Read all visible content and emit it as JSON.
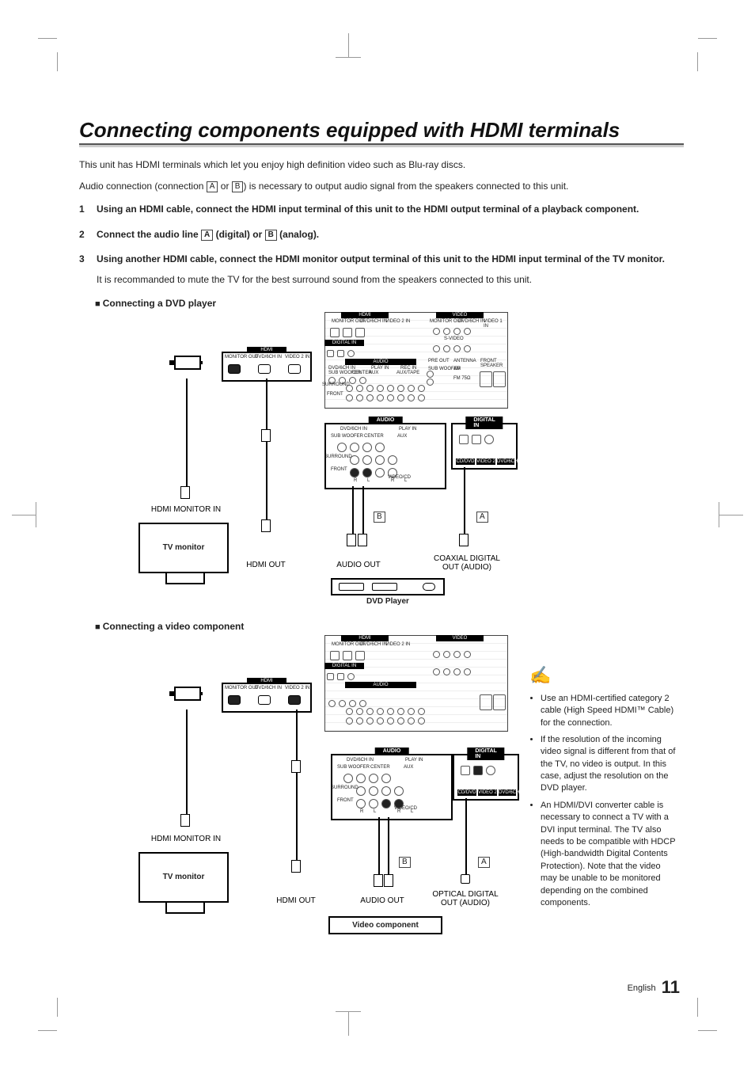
{
  "title": "Connecting components equipped with HDMI terminals",
  "intro1": "This unit has HDMI terminals which let you enjoy high definition video such as Blu-ray discs.",
  "intro2_pre": "Audio connection (connection ",
  "intro2_mid": " or ",
  "intro2_post": ") is necessary to output audio signal from the speakers connected to this unit.",
  "tagA": "A",
  "tagB": "B",
  "steps": [
    {
      "num": "1",
      "main": "Using an HDMI cable, connect the HDMI input terminal of this unit to the HDMI output terminal of a playback component.",
      "sub": ""
    },
    {
      "num": "2",
      "main_pre": "Connect the audio line ",
      "main_mid1": " (digital) or ",
      "main_mid2": " (analog).",
      "sub": ""
    },
    {
      "num": "3",
      "main": "Using another HDMI cable, connect the HDMI monitor output terminal of this unit to the HDMI input terminal of the TV monitor.",
      "sub": "It is recommanded to mute the TV for the best surround sound from the speakers connected to this unit."
    }
  ],
  "sub1": "Connecting a DVD player",
  "sub2": "Connecting a video component",
  "labels": {
    "tv": "TV monitor",
    "hdmi_monitor_in": "HDMI MONITOR IN",
    "hdmi_out": "HDMI OUT",
    "audio_out": "AUDIO OUT",
    "coax_out": "COAXIAL DIGITAL OUT (AUDIO)",
    "optical_out": "OPTICAL DIGITAL OUT (AUDIO)",
    "dvd_player": "DVD Player",
    "video_component": "Video component",
    "hdmi": "HDMI",
    "audio": "AUDIO",
    "digital_in": "DIGITAL IN",
    "monitor_out": "MONITOR OUT",
    "dvd6ch_in": "DVD/6CH IN",
    "video2_in": "VIDEO 2 IN",
    "play_in": "PLAY IN",
    "subwoofer": "SUB WOOFER",
    "center": "CENTER",
    "aux": "AUX",
    "surround": "SURROUND",
    "front": "FRONT",
    "cd_dvd": "CD/DVD",
    "video2": "VIDEO 2",
    "dvd6ch": "DVD/6CH",
    "rec_in": "REC IN",
    "aux_tape": "AUX/TAPE",
    "video": "VIDEO",
    "s_video": "S-VIDEO",
    "video1_in": "VIDEO 1 IN",
    "pre_out": "PRE OUT",
    "antenna": "ANTENNA",
    "front_speaker": "FRONT SPEAKER",
    "am": "AM",
    "fm": "FM 75Ω",
    "r": "R",
    "l": "L",
    "video_cd": "VIDEO/CD"
  },
  "notes": [
    "Use an HDMI-certified category 2 cable (High Speed HDMI™ Cable) for the connection.",
    "If the resolution of the incoming video signal is different from that of the TV, no video is output. In this case, adjust the resolution on the DVD player.",
    "An HDMI/DVI converter cable is necessary to connect a TV with a DVI input terminal. The TV also needs to be compatible with HDCP (High-bandwidth Digital Contents Protection). Note that the video may be unable to be monitored depending on the combined components."
  ],
  "footer_lang": "English",
  "footer_page": "11"
}
